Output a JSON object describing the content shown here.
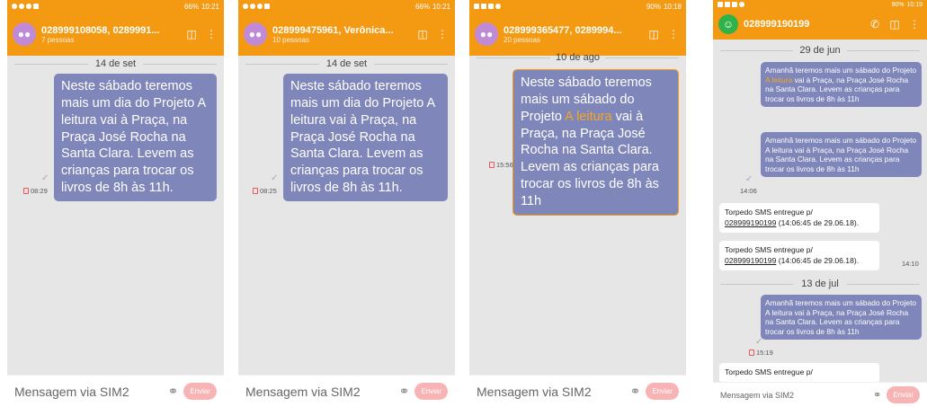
{
  "screens": [
    {
      "status": {
        "battery": "66%",
        "time": "10:21"
      },
      "header": {
        "title": "028999108058, 0289991...",
        "subtitle": "7 pessoas"
      },
      "date": "14 de set",
      "message": "Neste sábado teremos mais um dia do Projeto A leitura vai à Praça,  na Praça José Rocha na Santa Clara. Levem as crianças para trocar os livros de 8h às 11h.",
      "time": "08:29",
      "composer": {
        "placeholder": "Mensagem via SIM2",
        "send": "Enviar"
      }
    },
    {
      "status": {
        "battery": "66%",
        "time": "10:21"
      },
      "header": {
        "title": "028999475961, Verônica...",
        "subtitle": "10 pessoas"
      },
      "date": "14 de set",
      "message": "Neste sábado teremos mais um dia do Projeto A leitura vai à Praça,  na Praça José Rocha na Santa Clara. Levem as crianças para trocar os livros de 8h às 11h.",
      "time": "08:25",
      "composer": {
        "placeholder": "Mensagem via SIM2",
        "send": "Enviar"
      }
    },
    {
      "status": {
        "battery": "90%",
        "time": "10:18"
      },
      "header": {
        "title": "028999365477, 0289994...",
        "subtitle": "20 pessoas"
      },
      "date": "10 de ago",
      "message_a": "Neste sábado teremos mais um sábado do Projeto ",
      "message_hl": "A leitura",
      "message_b": " vai à Praça,  na Praça José Rocha na Santa Clara. Levem as crianças para trocar os livros de 8h às 11h",
      "time": "15:56",
      "composer": {
        "placeholder": "Mensagem via SIM2",
        "send": "Enviar"
      }
    },
    {
      "status": {
        "battery": "90%",
        "time": "10:19"
      },
      "header": {
        "title": "028999190199"
      },
      "date1": "29 de jun",
      "msg1_a": "Amanhã teremos mais um sábado do Projeto ",
      "msg1_hl": "A leitura",
      "msg1_b": " vai à Praça, na Praça José Rocha na Santa Clara. Levem as crianças para trocar os livros de 8h às 11h",
      "msg2": "Amanhã teremos mais um sábado do Projeto A leitura vai à Praça,  na Praça José Rocha na Santa Clara. Levem as crianças para trocar os livros de 8h às 11h",
      "time1": "14:06",
      "receipt1_a": "Torpedo SMS entregue p/",
      "receipt1_num": "028999190199",
      "receipt1_b": " (14:06:45 de 29.06.18).",
      "receipt2_a": "Torpedo SMS entregue p/",
      "receipt2_num": "028999190199",
      "receipt2_b": " (14:06:45 de 29.06.18).",
      "receipt_time": "14:10",
      "date2": "13 de jul",
      "msg3": "Amanhã teremos mais um sábado do Projeto A leitura vai à Praça, na Praça José Rocha na Santa Clara. Levem as crianças para trocar os livros de 8h às 11h",
      "time2": "15:19",
      "receipt3": "Torpedo SMS entregue p/",
      "composer": {
        "placeholder": "Mensagem via SIM2",
        "send": "Enviar"
      }
    }
  ]
}
